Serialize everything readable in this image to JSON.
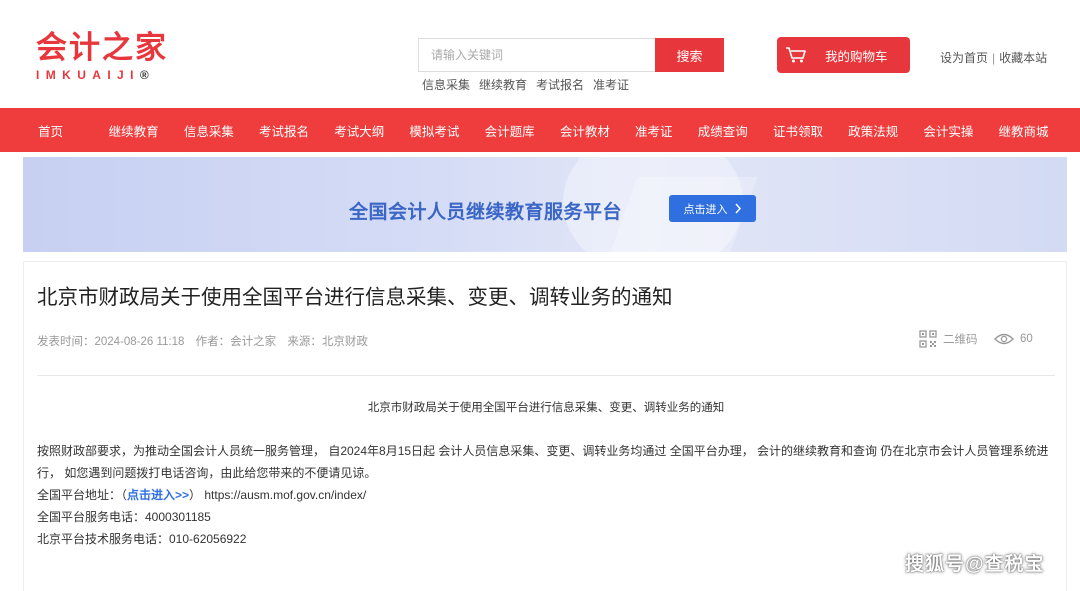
{
  "logo": {
    "cn": "会计之家",
    "en": "IMKUAIJI",
    "reg": "®"
  },
  "search": {
    "placeholder": "请输入关键词",
    "button": "搜索",
    "hot": [
      "信息采集",
      "继续教育",
      "考试报名",
      "准考证"
    ]
  },
  "cart": {
    "label": "我的购物车"
  },
  "toplinks": {
    "home": "设为首页",
    "sep": "|",
    "fav": "收藏本站"
  },
  "nav": [
    "首页",
    "继续教育",
    "信息采集",
    "考试报名",
    "考试大纲",
    "模拟考试",
    "会计题库",
    "会计教材",
    "准考证",
    "成绩查询",
    "证书领取",
    "政策法规",
    "会计实操",
    "继教商城"
  ],
  "banner": {
    "title": "全国会计人员继续教育服务平台",
    "button": "点击进入"
  },
  "article": {
    "title": "北京市财政局关于使用全国平台进行信息采集、变更、调转业务的通知",
    "meta": {
      "time": "发表时间：2024-08-26 11:18",
      "author": "作者：会计之家",
      "source": "来源：北京财政"
    },
    "qr_label": "二维码",
    "views": "60",
    "subtitle": "北京市财政局关于使用全国平台进行信息采集、变更、调转业务的通知",
    "para1": "按照财政部要求，为推动全国会计人员统一服务管理， 自2024年8月15日起 会计人员信息采集、变更、调转业务均通过 全国平台办理， 会计的继续教育和查询 仍在北京市会计人员管理系统进行， 如您遇到问题拨打电话咨询，由此给您带来的不便请见谅。",
    "addr_label": "全国平台地址：（",
    "addr_link": "点击进入>>",
    "addr_tail": "） https://ausm.mof.gov.cn/index/",
    "phone1": "全国平台服务电话：4000301185",
    "phone2": "北京平台技术服务电话：010-62056922"
  },
  "watermark": "搜狐号@查税宝",
  "colors": {
    "brand": "#e8373c",
    "nav": "#ef3c3d",
    "link": "#2f6fe0"
  }
}
